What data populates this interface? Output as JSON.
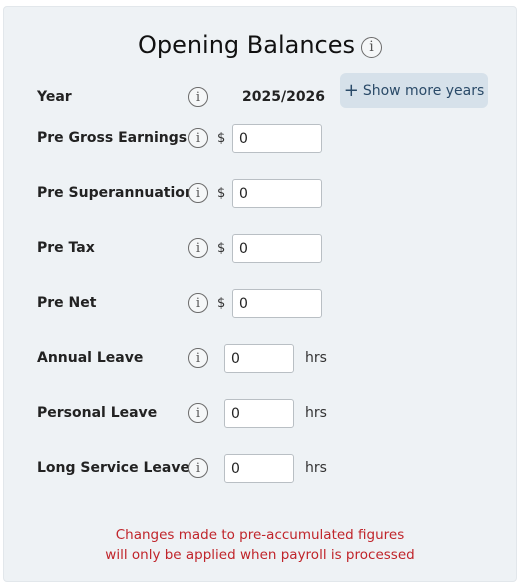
{
  "title": "Opening Balances",
  "info_glyph": "i",
  "year": {
    "label": "Year",
    "value": "2025/2026",
    "show_more_label": "Show more years",
    "show_more_icon": "+"
  },
  "fields": {
    "pre_gross_earnings": {
      "label": "Pre Gross Earnings",
      "currency": "$",
      "value": "0"
    },
    "pre_superannuation": {
      "label": "Pre Superannuation",
      "currency": "$",
      "value": "0"
    },
    "pre_tax": {
      "label": "Pre Tax",
      "currency": "$",
      "value": "0"
    },
    "pre_net": {
      "label": "Pre Net",
      "currency": "$",
      "value": "0"
    },
    "annual_leave": {
      "label": "Annual Leave",
      "value": "0",
      "unit": "hrs"
    },
    "personal_leave": {
      "label": "Personal Leave",
      "value": "0",
      "unit": "hrs"
    },
    "long_service_leave": {
      "label": "Long Service Leave",
      "value": "0",
      "unit": "hrs"
    }
  },
  "note": {
    "line1": "Changes made to pre-accumulated figures",
    "line2": "will only be applied when payroll is processed"
  },
  "colors": {
    "panel_bg": "#eef2f5",
    "button_bg": "#d6e1ea",
    "button_text": "#2a4a68",
    "warning_text": "#c0242a"
  }
}
